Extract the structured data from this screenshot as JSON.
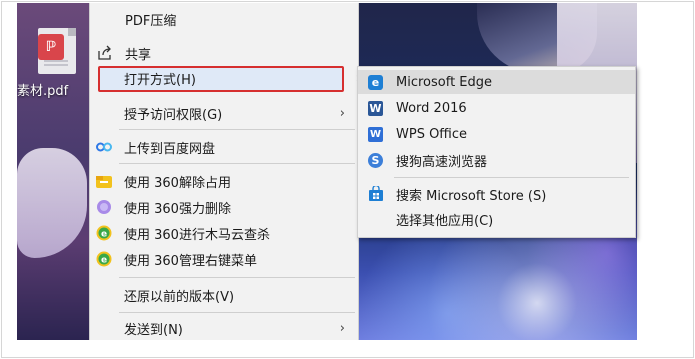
{
  "desktop": {
    "file_name": "素材.pdf"
  },
  "context_menu": {
    "items": [
      {
        "label": "PDF压缩",
        "icon": "none"
      },
      {
        "label": "共享",
        "icon": "share-icon"
      },
      {
        "label": "打开方式(H)",
        "icon": "none",
        "has_submenu": true
      },
      {
        "label": "授予访问权限(G)",
        "icon": "none",
        "has_submenu": true
      },
      {
        "label": "上传到百度网盘",
        "icon": "baidu-netdisk-icon"
      },
      {
        "label": "使用 360解除占用",
        "icon": "360-unlock-icon"
      },
      {
        "label": "使用 360强力删除",
        "icon": "360-delete-icon"
      },
      {
        "label": "使用 360进行木马云查杀",
        "icon": "360-scan-icon"
      },
      {
        "label": "使用 360管理右键菜单",
        "icon": "360-menu-icon"
      },
      {
        "label": "还原以前的版本(V)",
        "icon": "none"
      },
      {
        "label": "发送到(N)",
        "icon": "none",
        "has_submenu": true
      }
    ],
    "submenu_arrow": "›"
  },
  "open_with_submenu": {
    "items": [
      {
        "label": "Microsoft Edge",
        "icon": "edge-icon",
        "icon_text": "e"
      },
      {
        "label": "Word 2016",
        "icon": "word-icon",
        "icon_text": "W"
      },
      {
        "label": "WPS Office",
        "icon": "wps-icon",
        "icon_text": "W"
      },
      {
        "label": "搜狗高速浏览器",
        "icon": "sogou-browser-icon",
        "icon_text": "S"
      },
      {
        "label": "搜索 Microsoft Store (S)",
        "icon": "store-icon",
        "icon_text": ""
      },
      {
        "label": "选择其他应用(C)",
        "icon": "none",
        "icon_text": ""
      }
    ]
  },
  "colors": {
    "highlight_border": "#d62f2f",
    "menu_bg": "#f2f2f2",
    "edge_blue": "#1e7fd4",
    "word_blue": "#2b5797",
    "wps_blue": "#2f6fd6",
    "baidu_blue": "#2e78e6",
    "green_360": "#3aa847",
    "yellow_360": "#f2c21d"
  }
}
